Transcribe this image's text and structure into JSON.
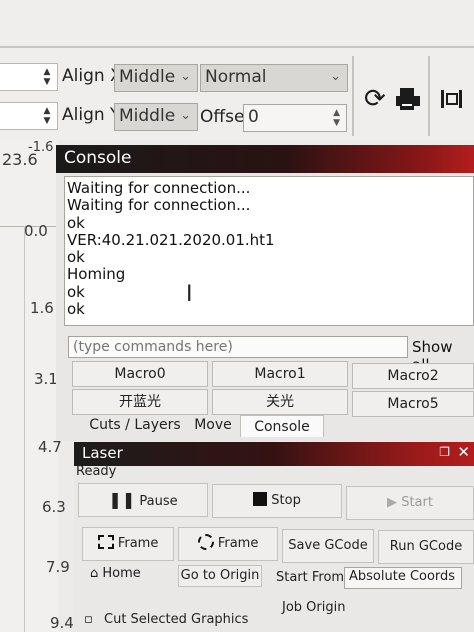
{
  "toolbar": {
    "align_x_label": "Align X",
    "align_x_value": "Middle",
    "mode_value": "Normal",
    "align_y_label": "Align Y",
    "align_y_value": "Middle",
    "offset_label": "Offset",
    "offset_value": "0"
  },
  "ruler": {
    "top_a": "-1.6",
    "top_b": "23.6",
    "ticks": [
      "0.0",
      "1.6",
      "3.1",
      "4.7",
      "6.3",
      "7.9",
      "9.4"
    ]
  },
  "console": {
    "title": "Console",
    "log": [
      "Waiting for connection...",
      "Waiting for connection...",
      "ok",
      "VER:40.21.021.2020.01.ht1",
      "ok",
      "Homing",
      "ok",
      "ok"
    ],
    "input_placeholder": "(type commands here)",
    "show_all": "Show all",
    "macros": [
      "Macro0",
      "Macro1",
      "Macro2",
      "开蓝光",
      "关光",
      "Macro5"
    ],
    "tabs": [
      "Cuts / Layers",
      "Move",
      "Console"
    ]
  },
  "laser": {
    "title": "Laser",
    "status": "Ready",
    "pause": "Pause",
    "stop": "Stop",
    "start": "Start",
    "frame1": "Frame",
    "frame2": "Frame",
    "save_gcode": "Save GCode",
    "run_gcode": "Run GCode",
    "home": "Home",
    "go_to_origin": "Go to Origin",
    "start_from_label": "Start From:",
    "start_from_value": "Absolute Coords",
    "cut_selected": "Cut Selected Graphics",
    "job_origin": "Job Origin"
  }
}
